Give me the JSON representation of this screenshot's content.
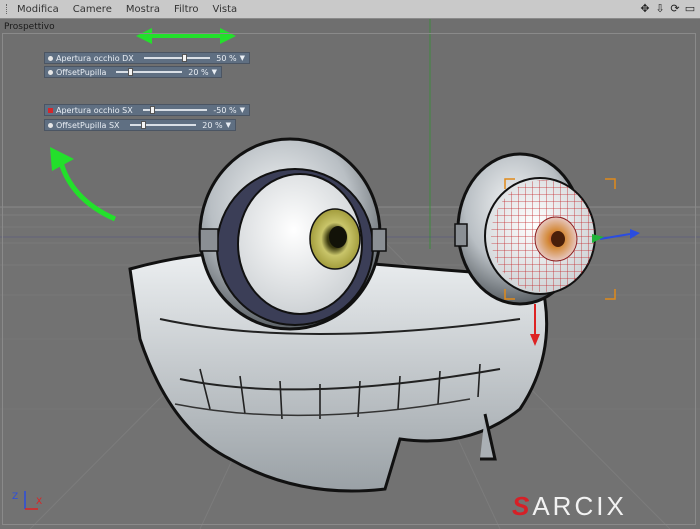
{
  "menubar": {
    "items": [
      "Modifica",
      "Camere",
      "Mostra",
      "Filtro",
      "Vista"
    ],
    "tool_icons": [
      "move-icon",
      "pin-icon",
      "sync-icon",
      "window-icon"
    ]
  },
  "viewport": {
    "label": "Prospettivo"
  },
  "params": [
    {
      "label": "Apertura occhio DX",
      "value": "50 %",
      "fill": 0.6
    },
    {
      "label": "OffsetPupilla",
      "value": "20 %",
      "fill": 0.2
    },
    {
      "label": "Apertura occhio SX",
      "value": "-50 %",
      "fill": 0.15
    },
    {
      "label": "OffsetPupilla SX",
      "value": "20 %",
      "fill": 0.2
    }
  ],
  "logo": {
    "mark": "S",
    "text": "ARCIX"
  },
  "axis": {
    "z": "Z",
    "x": "X"
  },
  "colors": {
    "arrow": "#23e02b",
    "accent": "#d62027",
    "panel": "#5f6f82"
  }
}
